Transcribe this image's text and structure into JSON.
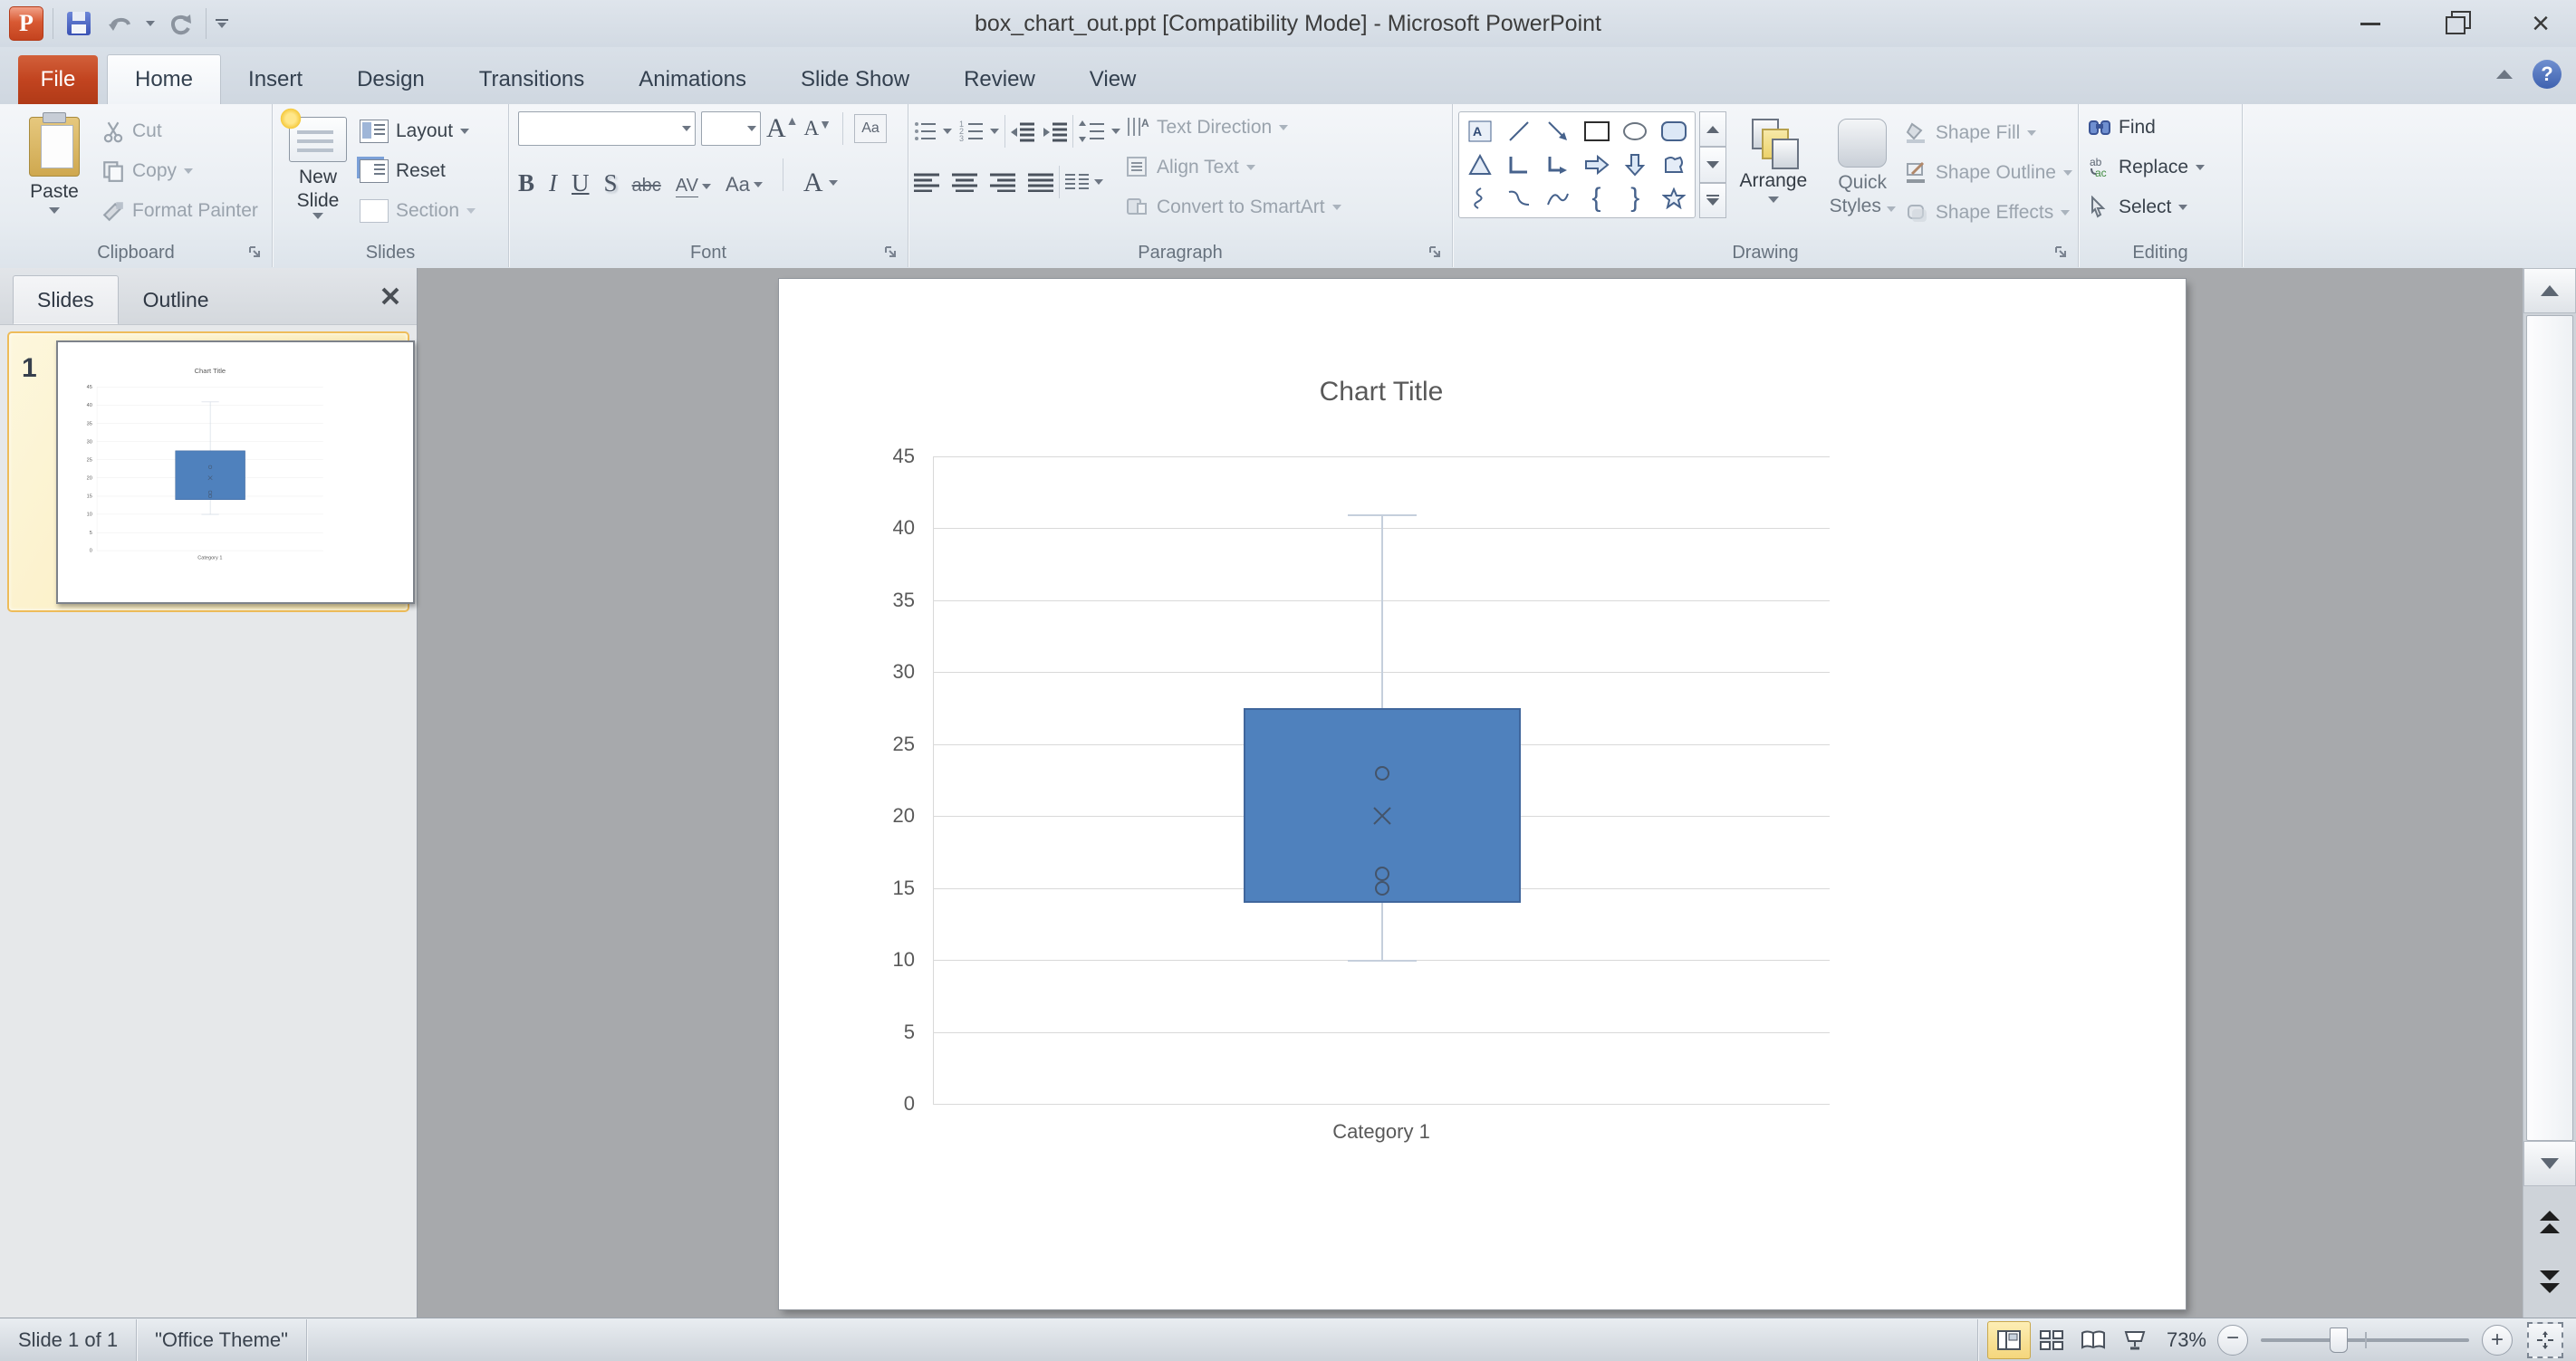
{
  "window": {
    "title": "box_chart_out.ppt [Compatibility Mode]  -  Microsoft PowerPoint"
  },
  "ribbon": {
    "file_label": "File",
    "tabs": [
      "Home",
      "Insert",
      "Design",
      "Transitions",
      "Animations",
      "Slide Show",
      "Review",
      "View"
    ],
    "active_tab": "Home",
    "clipboard": {
      "title": "Clipboard",
      "paste": "Paste",
      "cut": "Cut",
      "copy": "Copy",
      "format_painter": "Format Painter"
    },
    "slides": {
      "title": "Slides",
      "new_slide_1": "New",
      "new_slide_2": "Slide",
      "layout": "Layout",
      "reset": "Reset",
      "section": "Section"
    },
    "font": {
      "title": "Font",
      "bold": "B",
      "italic": "I",
      "underline": "U",
      "shadow": "S",
      "strikethrough": "abc",
      "spacing": "AV",
      "case": "Aa",
      "color": "A"
    },
    "paragraph": {
      "title": "Paragraph",
      "text_direction": "Text Direction",
      "align_text": "Align Text",
      "convert_smartart": "Convert to SmartArt"
    },
    "drawing": {
      "title": "Drawing",
      "arrange": "Arrange",
      "quick_styles_1": "Quick",
      "quick_styles_2": "Styles",
      "shape_fill": "Shape Fill",
      "shape_outline": "Shape Outline",
      "shape_effects": "Shape Effects"
    },
    "editing": {
      "title": "Editing",
      "find": "Find",
      "replace": "Replace",
      "select": "Select"
    }
  },
  "slides_panel": {
    "tab_slides": "Slides",
    "tab_outline": "Outline",
    "slide_number": "1"
  },
  "status_bar": {
    "slide_counter": "Slide 1 of 1",
    "theme": "\"Office Theme\"",
    "zoom_level": "73%"
  },
  "chart_data": {
    "type": "box",
    "title": "Chart Title",
    "categories": [
      "Category 1"
    ],
    "series": [
      {
        "name": "Category 1",
        "q1": 14,
        "q3": 27.5,
        "whisker_low": 10,
        "whisker_high": 41,
        "mean": 20,
        "data_points": [
          23,
          16,
          15
        ]
      }
    ],
    "ylim": [
      0,
      45
    ],
    "ytick_step": 5,
    "grid": true,
    "legend": false,
    "colors": {
      "box_fill": "#4f81bd",
      "box_border": "#40669c",
      "marker": "#44546a",
      "gridline": "#d9d9d9",
      "whisker": "#c5cfdc",
      "axis_text": "#595959",
      "title_text": "#595959"
    }
  }
}
